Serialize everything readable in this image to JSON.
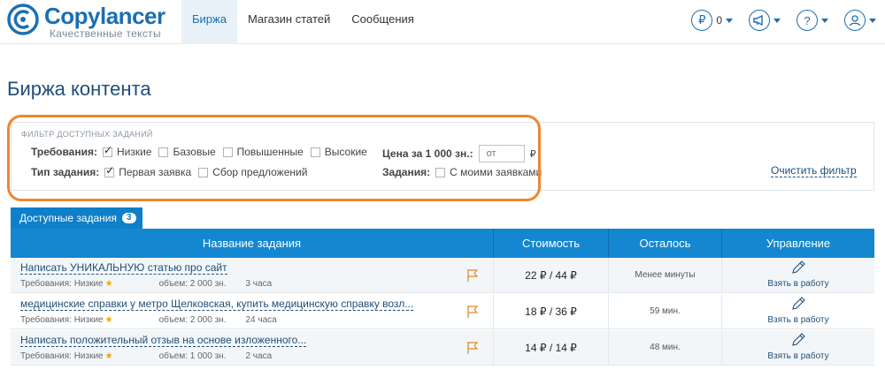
{
  "header": {
    "logo_name": "Copylancer",
    "logo_tagline": "Качественные тексты",
    "nav": [
      {
        "label": "Биржа",
        "active": true
      },
      {
        "label": "Магазин статей",
        "active": false
      },
      {
        "label": "Сообщения",
        "active": false
      }
    ],
    "balance": "0",
    "icons": [
      "ruble-icon",
      "megaphone-icon",
      "help-icon",
      "user-icon"
    ],
    "brand_color": "#1a6fb3"
  },
  "page_title": "Биржа контента",
  "filter": {
    "legend": "ФИЛЬТР ДОСТУПНЫХ ЗАДАНИЙ",
    "requirements_label": "Требования:",
    "requirements": [
      {
        "label": "Низкие",
        "checked": true
      },
      {
        "label": "Базовые",
        "checked": false
      },
      {
        "label": "Повышенные",
        "checked": false
      },
      {
        "label": "Высокие",
        "checked": false
      }
    ],
    "type_label": "Тип задания:",
    "types": [
      {
        "label": "Первая заявка",
        "checked": true
      },
      {
        "label": "Сбор предложений",
        "checked": false
      }
    ],
    "price_label": "Цена за 1 000 зн.:",
    "price_placeholder": "от",
    "price_currency": "₽",
    "tasks_label": "Задания:",
    "tasks_option": {
      "label": "С моими заявками",
      "checked": false
    },
    "clear_label": "Очистить фильтр",
    "highlight_color": "#f0862e"
  },
  "tab": {
    "label": "Доступные задания",
    "count": "3"
  },
  "table": {
    "columns": [
      "Название задания",
      "Стоимость",
      "Осталось",
      "Управление"
    ],
    "rows": [
      {
        "title": "Написать УНИКАЛЬНУЮ статью про сайт",
        "requirement": "Требования: Низкие",
        "volume": "объем: 2 000 зн.",
        "duration": "3 часа",
        "cost": "22 ₽ / 44 ₽",
        "remaining": "Менее минуты",
        "action": "Взять в работу"
      },
      {
        "title": "медицинские справки у метро Щелковская, купить медицинскую справку возл...",
        "requirement": "Требования: Низкие",
        "volume": "объем: 2 000 зн.",
        "duration": "24 часа",
        "cost": "18 ₽ / 36 ₽",
        "remaining": "59 мин.",
        "action": "Взять в работу"
      },
      {
        "title": "Написать положительный отзыв на основе изложенного...",
        "requirement": "Требования: Низкие",
        "volume": "объем: 1 000 зн.",
        "duration": "2 часа",
        "cost": "14 ₽ / 14 ₽",
        "remaining": "48 мин.",
        "action": "Взять в работу"
      }
    ]
  }
}
